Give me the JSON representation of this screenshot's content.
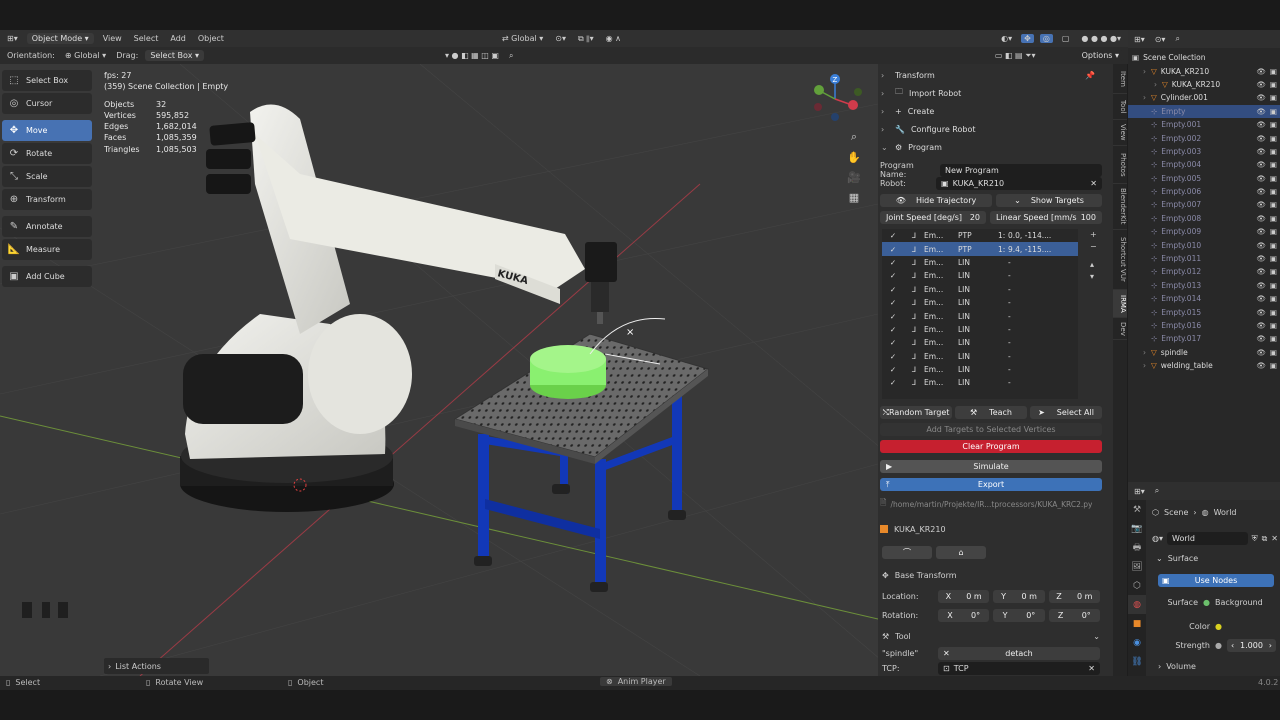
{
  "header": {
    "mode": "Object Mode",
    "menus": [
      "View",
      "Select",
      "Add",
      "Object"
    ],
    "orientation_label": "Orientation:",
    "orientation_value": "Global",
    "drag_label": "Drag:",
    "drag_value": "Select Box",
    "transform_space": "Global",
    "options_label": "Options"
  },
  "toolbar": {
    "tools": [
      {
        "label": "Select Box",
        "icon": "select-box-icon"
      },
      {
        "label": "Cursor",
        "icon": "cursor-icon"
      },
      {
        "label": "Move",
        "icon": "move-icon",
        "active": true
      },
      {
        "label": "Rotate",
        "icon": "rotate-icon"
      },
      {
        "label": "Scale",
        "icon": "scale-icon"
      },
      {
        "label": "Transform",
        "icon": "transform-icon"
      },
      {
        "label": "Annotate",
        "icon": "annotate-icon"
      },
      {
        "label": "Measure",
        "icon": "measure-icon"
      },
      {
        "label": "Add Cube",
        "icon": "add-cube-icon"
      }
    ]
  },
  "stats": {
    "fps": "fps: 27",
    "collection": "(359) Scene Collection | Empty",
    "rows": [
      {
        "label": "Objects",
        "value": "32"
      },
      {
        "label": "Vertices",
        "value": "595,852"
      },
      {
        "label": "Edges",
        "value": "1,682,014"
      },
      {
        "label": "Faces",
        "value": "1,085,359"
      },
      {
        "label": "Triangles",
        "value": "1,085,503"
      }
    ]
  },
  "viewport": {
    "robot_brand": "KUKA",
    "list_actions": "List Actions"
  },
  "npanel": {
    "sections": [
      "Transform",
      "Import Robot",
      "Create",
      "Configure Robot",
      "Program"
    ],
    "program_name_label": "Program Name:",
    "program_name_value": "New Program",
    "robot_label": "Robot:",
    "robot_value": "KUKA_KR210",
    "hide_trajectory": "Hide Trajectory",
    "show_targets": "Show Targets",
    "joint_speed_label": "Joint Speed [deg/s]",
    "joint_speed_value": "20",
    "linear_speed_label": "Linear Speed [mm/s",
    "linear_speed_value": "100",
    "program_rows": [
      {
        "name": "Em...",
        "type": "PTP",
        "n": "1:",
        "value": "0.0, -114....",
        "selected": false
      },
      {
        "name": "Em...",
        "type": "PTP",
        "n": "1:",
        "value": "9.4, -115....",
        "selected": true
      },
      {
        "name": "Em...",
        "type": "LIN",
        "n": "",
        "value": "-",
        "selected": false
      },
      {
        "name": "Em...",
        "type": "LIN",
        "n": "",
        "value": "-",
        "selected": false
      },
      {
        "name": "Em...",
        "type": "LIN",
        "n": "",
        "value": "-",
        "selected": false
      },
      {
        "name": "Em...",
        "type": "LIN",
        "n": "",
        "value": "-",
        "selected": false
      },
      {
        "name": "Em...",
        "type": "LIN",
        "n": "",
        "value": "-",
        "selected": false
      },
      {
        "name": "Em...",
        "type": "LIN",
        "n": "",
        "value": "-",
        "selected": false
      },
      {
        "name": "Em...",
        "type": "LIN",
        "n": "",
        "value": "-",
        "selected": false
      },
      {
        "name": "Em...",
        "type": "LIN",
        "n": "",
        "value": "-",
        "selected": false
      },
      {
        "name": "Em...",
        "type": "LIN",
        "n": "",
        "value": "-",
        "selected": false
      },
      {
        "name": "Em...",
        "type": "LIN",
        "n": "",
        "value": "-",
        "selected": false
      }
    ],
    "random_target": "Random Target",
    "teach": "Teach",
    "select_all": "Select All",
    "add_targets": "Add Targets to Selected Vertices",
    "clear_program": "Clear Program",
    "simulate": "Simulate",
    "export": "Export",
    "export_path": "/home/martin/Projekte/IR...tprocessors/KUKA_KRC2.py",
    "robot_panel": "KUKA_KR210",
    "base_transform": "Base Transform",
    "location_label": "Location:",
    "rotation_label": "Rotation:",
    "location": [
      {
        "axis": "X",
        "value": "0 m"
      },
      {
        "axis": "Y",
        "value": "0 m"
      },
      {
        "axis": "Z",
        "value": "0 m"
      }
    ],
    "rotation": [
      {
        "axis": "X",
        "value": "0°"
      },
      {
        "axis": "Y",
        "value": "0°"
      },
      {
        "axis": "Z",
        "value": "0°"
      }
    ],
    "tool_label": "Tool",
    "tool_name": "\"spindle\"",
    "detach": "detach",
    "tcp_label": "TCP:",
    "tcp_value": "TCP"
  },
  "side_tabs": [
    "Item",
    "Tool",
    "View",
    "Photos",
    "BlenderKit",
    "Shortcut VUr",
    "IRMA",
    "Dev"
  ],
  "outliner": {
    "rows": [
      {
        "label": "Scene Collection",
        "indent": 0,
        "dim": false,
        "sel": false
      },
      {
        "label": "KUKA_KR210",
        "indent": 1,
        "dim": false,
        "sel": false
      },
      {
        "label": "KUKA_KR210",
        "indent": 2,
        "dim": false,
        "sel": false
      },
      {
        "label": "Cylinder.001",
        "indent": 1,
        "dim": false,
        "sel": false
      },
      {
        "label": "Empty",
        "indent": 1,
        "dim": true,
        "sel": true
      },
      {
        "label": "Empty.001",
        "indent": 1,
        "dim": true,
        "sel": false
      },
      {
        "label": "Empty.002",
        "indent": 1,
        "dim": true,
        "sel": false
      },
      {
        "label": "Empty.003",
        "indent": 1,
        "dim": true,
        "sel": false
      },
      {
        "label": "Empty.004",
        "indent": 1,
        "dim": true,
        "sel": false
      },
      {
        "label": "Empty.005",
        "indent": 1,
        "dim": true,
        "sel": false
      },
      {
        "label": "Empty.006",
        "indent": 1,
        "dim": true,
        "sel": false
      },
      {
        "label": "Empty.007",
        "indent": 1,
        "dim": true,
        "sel": false
      },
      {
        "label": "Empty.008",
        "indent": 1,
        "dim": true,
        "sel": false
      },
      {
        "label": "Empty.009",
        "indent": 1,
        "dim": true,
        "sel": false
      },
      {
        "label": "Empty.010",
        "indent": 1,
        "dim": true,
        "sel": false
      },
      {
        "label": "Empty.011",
        "indent": 1,
        "dim": true,
        "sel": false
      },
      {
        "label": "Empty.012",
        "indent": 1,
        "dim": true,
        "sel": false
      },
      {
        "label": "Empty.013",
        "indent": 1,
        "dim": true,
        "sel": false
      },
      {
        "label": "Empty.014",
        "indent": 1,
        "dim": true,
        "sel": false
      },
      {
        "label": "Empty.015",
        "indent": 1,
        "dim": true,
        "sel": false
      },
      {
        "label": "Empty.016",
        "indent": 1,
        "dim": true,
        "sel": false
      },
      {
        "label": "Empty.017",
        "indent": 1,
        "dim": true,
        "sel": false
      },
      {
        "label": "spindle",
        "indent": 1,
        "dim": false,
        "sel": false
      },
      {
        "label": "welding_table",
        "indent": 1,
        "dim": false,
        "sel": false
      }
    ]
  },
  "properties": {
    "breadcrumb_scene": "Scene",
    "breadcrumb_world": "World",
    "world_name": "World",
    "surface_label": "Surface",
    "use_nodes": "Use Nodes",
    "surface_field_label": "Surface",
    "surface_value": "Background",
    "color_label": "Color",
    "strength_label": "Strength",
    "strength_value": "1.000",
    "volume_label": "Volume",
    "version": "4.0.2"
  },
  "statusbar": {
    "select": "Select",
    "rotate_view": "Rotate View",
    "object": "Object",
    "anim_player": "Anim Player"
  }
}
